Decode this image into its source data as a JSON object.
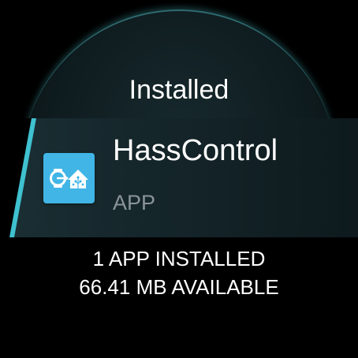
{
  "header": {
    "title": "Installed"
  },
  "app": {
    "name": "HassControl",
    "type": "APP",
    "icon": "hasscontrol-app-icon"
  },
  "status": {
    "installed_count": "1 APP INSTALLED",
    "storage_available": "66.41 MB AVAILABLE"
  },
  "colors": {
    "accent": "#3fc1d0",
    "icon_background": "#41b5e6",
    "row_background": "#17292d",
    "secondary_text": "#8a9498"
  }
}
